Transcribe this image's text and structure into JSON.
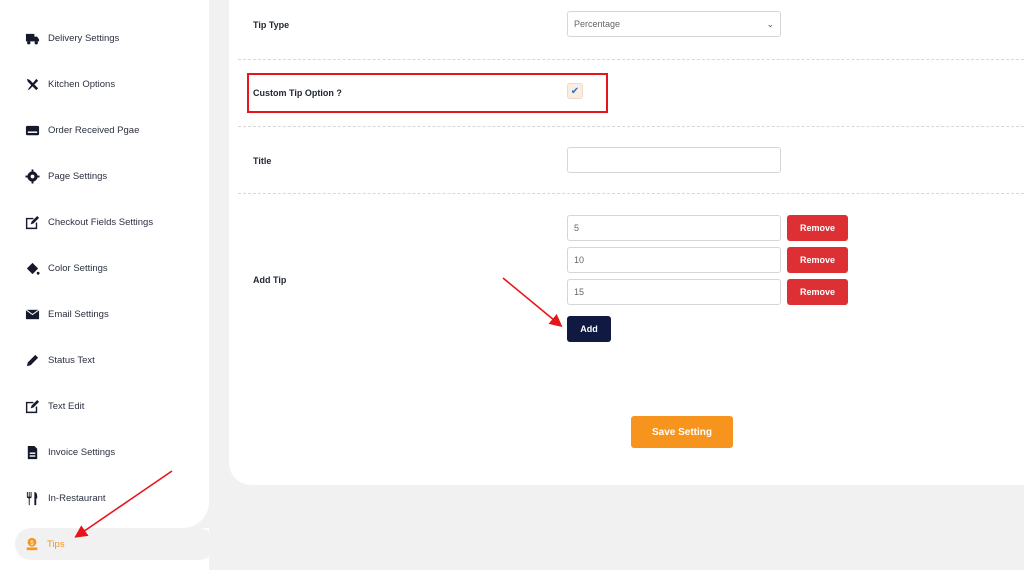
{
  "sidebar": {
    "items": [
      {
        "label": "Delivery Settings",
        "icon": "truck-icon"
      },
      {
        "label": "Kitchen Options",
        "icon": "tools-icon"
      },
      {
        "label": "Order Received Pgae",
        "icon": "card-icon"
      },
      {
        "label": "Page Settings",
        "icon": "gear-icon"
      },
      {
        "label": "Checkout Fields Settings",
        "icon": "edit-icon"
      },
      {
        "label": "Color Settings",
        "icon": "paint-bucket-icon"
      },
      {
        "label": "Email Settings",
        "icon": "envelope-icon"
      },
      {
        "label": "Status Text",
        "icon": "pencil-icon"
      },
      {
        "label": "Text Edit",
        "icon": "edit-icon"
      },
      {
        "label": "Invoice Settings",
        "icon": "file-invoice-icon"
      },
      {
        "label": "In-Restaurant",
        "icon": "utensils-icon"
      }
    ],
    "active": {
      "label": "Tips",
      "icon": "coin-hand-icon"
    },
    "active_color": "#f7941d"
  },
  "form": {
    "tip_type": {
      "label": "Tip Type",
      "value": "Percentage"
    },
    "custom_tip": {
      "label": "Custom Tip Option ?",
      "checked": true
    },
    "title": {
      "label": "Title",
      "value": ""
    },
    "add_tip": {
      "label": "Add Tip",
      "tips": [
        "5",
        "10",
        "15"
      ],
      "remove_label": "Remove",
      "add_label": "Add"
    },
    "save_label": "Save Setting"
  },
  "colors": {
    "primary": "#0f1941",
    "accent": "#f7941d",
    "danger": "#dc3035",
    "highlight": "#e8141b"
  }
}
